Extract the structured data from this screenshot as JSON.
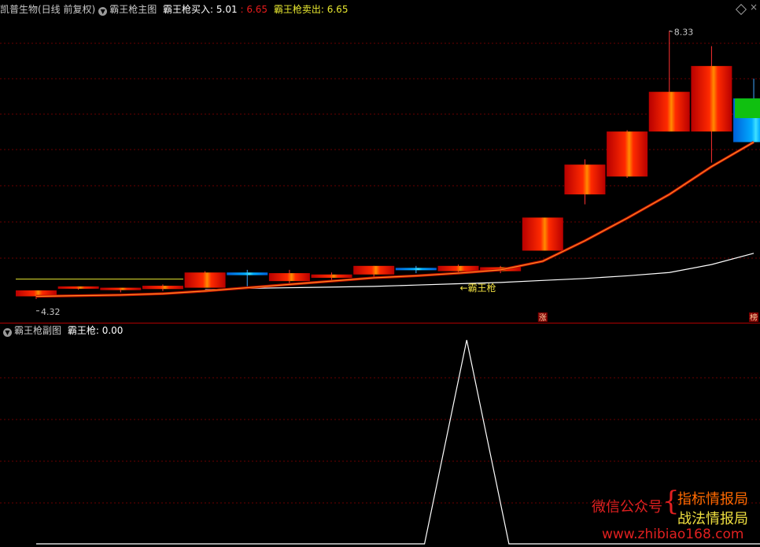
{
  "main_header": {
    "stock": "凯普生物(日线 前复权)",
    "indicator": "霸王枪主图",
    "buy_label": "霸王枪买入:",
    "buy_value": "5.01",
    "buy_value2": "6.65",
    "sell_label": "霸王枪卖出:",
    "sell_value": "6.65"
  },
  "sub_header": {
    "indicator": "霸王枪副图",
    "label": "霸王枪:",
    "value": "0.00"
  },
  "watermark": {
    "left": "微信公众号",
    "right_top": "指标情报局",
    "right_bottom": "战法情报局",
    "url": "www.zhibiao168.com"
  },
  "colors": {
    "bull": "#e01010",
    "bear": "#00a8ff",
    "sell": "#e8e830",
    "divider": "#b00000",
    "grid": "#6a0000",
    "line": "#ffffff"
  },
  "chart_data": [
    {
      "type": "candlestick",
      "title": "霸王枪主图",
      "ylim": [
        4.1,
        8.5
      ],
      "candles": [
        {
          "o": 4.32,
          "h": 4.4,
          "l": 4.28,
          "c": 4.41,
          "mark": "4.32"
        },
        {
          "o": 4.45,
          "h": 4.47,
          "l": 4.42,
          "c": 4.47
        },
        {
          "o": 4.42,
          "h": 4.45,
          "l": 4.38,
          "c": 4.45
        },
        {
          "o": 4.43,
          "h": 4.5,
          "l": 4.4,
          "c": 4.48
        },
        {
          "o": 4.45,
          "h": 4.7,
          "l": 4.45,
          "c": 4.68
        },
        {
          "o": 4.68,
          "h": 4.72,
          "l": 4.47,
          "c": 4.64
        },
        {
          "o": 4.55,
          "h": 4.72,
          "l": 4.52,
          "c": 4.67
        },
        {
          "o": 4.6,
          "h": 4.68,
          "l": 4.55,
          "c": 4.65
        },
        {
          "o": 4.65,
          "h": 4.78,
          "l": 4.6,
          "c": 4.78
        },
        {
          "o": 4.75,
          "h": 4.78,
          "l": 4.67,
          "c": 4.72
        },
        {
          "o": 4.7,
          "h": 4.8,
          "l": 4.67,
          "c": 4.78
        },
        {
          "o": 4.7,
          "h": 4.78,
          "l": 4.67,
          "c": 4.76
        },
        {
          "o": 5.01,
          "h": 5.51,
          "l": 5.01,
          "c": 5.51
        },
        {
          "o": 5.86,
          "h": 6.39,
          "l": 5.71,
          "c": 6.31
        },
        {
          "o": 6.13,
          "h": 6.83,
          "l": 6.11,
          "c": 6.81
        },
        {
          "o": 6.81,
          "h": 8.33,
          "l": 6.81,
          "c": 7.41,
          "mark": "8.33"
        },
        {
          "o": 6.81,
          "h": 8.1,
          "l": 6.34,
          "c": 7.8
        },
        {
          "o": 7.31,
          "h": 7.61,
          "l": 6.76,
          "c": 6.65
        }
      ],
      "sell_line": {
        "from": 0,
        "to": 3,
        "value": 4.58
      },
      "signal_line": [
        4.32,
        4.33,
        4.34,
        4.36,
        4.4,
        4.45,
        4.5,
        4.55,
        4.6,
        4.63,
        4.67,
        4.72,
        4.85,
        5.16,
        5.5,
        5.86,
        6.28,
        6.65
      ],
      "white_line": [
        null,
        null,
        null,
        null,
        4.42,
        4.44,
        4.45,
        4.46,
        4.47,
        4.49,
        4.51,
        4.53,
        4.56,
        4.59,
        4.63,
        4.68,
        4.8,
        4.97
      ],
      "annotations": [
        {
          "text": "←霸王枪",
          "index": 10
        },
        {
          "text": "涨",
          "index": 12
        },
        {
          "text": "榜",
          "index": 17
        }
      ]
    },
    {
      "type": "line",
      "title": "霸王枪副图",
      "ylim": [
        0,
        1
      ],
      "x": [
        0,
        9.2,
        10.2,
        11.2,
        17.2
      ],
      "y": [
        0,
        0,
        1,
        0,
        0
      ]
    }
  ]
}
